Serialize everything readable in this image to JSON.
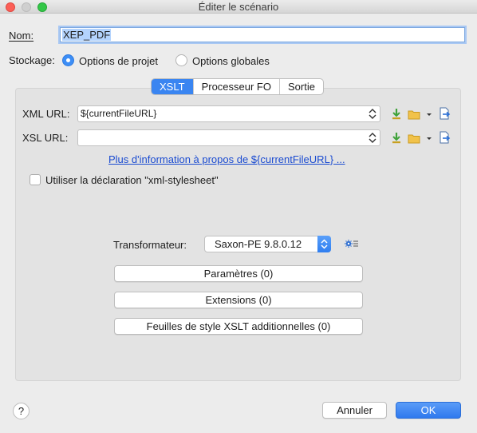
{
  "window": {
    "title": "Éditer le scénario"
  },
  "name": {
    "label": "Nom:",
    "value": "XEP_PDF"
  },
  "storage": {
    "label": "Stockage:",
    "options": [
      {
        "label": "Options de projet",
        "selected": true
      },
      {
        "label": "Options globales",
        "selected": false
      }
    ]
  },
  "tabs": [
    {
      "label": "XSLT",
      "active": true
    },
    {
      "label": "Processeur FO",
      "active": false
    },
    {
      "label": "Sortie",
      "active": false
    }
  ],
  "xml_url": {
    "label": "XML URL:",
    "value": "${currentFileURL}"
  },
  "xsl_url": {
    "label": "XSL URL:",
    "value": ""
  },
  "info_link": "Plus d'information à propos de ${currentFileURL} ...",
  "xml_stylesheet_checkbox": {
    "label": "Utiliser la déclaration \"xml-stylesheet\"",
    "checked": false
  },
  "transformer": {
    "label": "Transformateur:",
    "value": "Saxon-PE 9.8.0.12"
  },
  "buttons": {
    "parameters": "Paramètres (0)",
    "extensions": "Extensions (0)",
    "additional_xslt": "Feuilles de style XSLT additionnelles (0)"
  },
  "footer": {
    "help": "?",
    "cancel": "Annuler",
    "ok": "OK"
  },
  "colors": {
    "accent": "#3a85f1",
    "link": "#1a4bd1",
    "insert_icon": "#3fa23a",
    "folder_icon": "#f1c24a"
  }
}
